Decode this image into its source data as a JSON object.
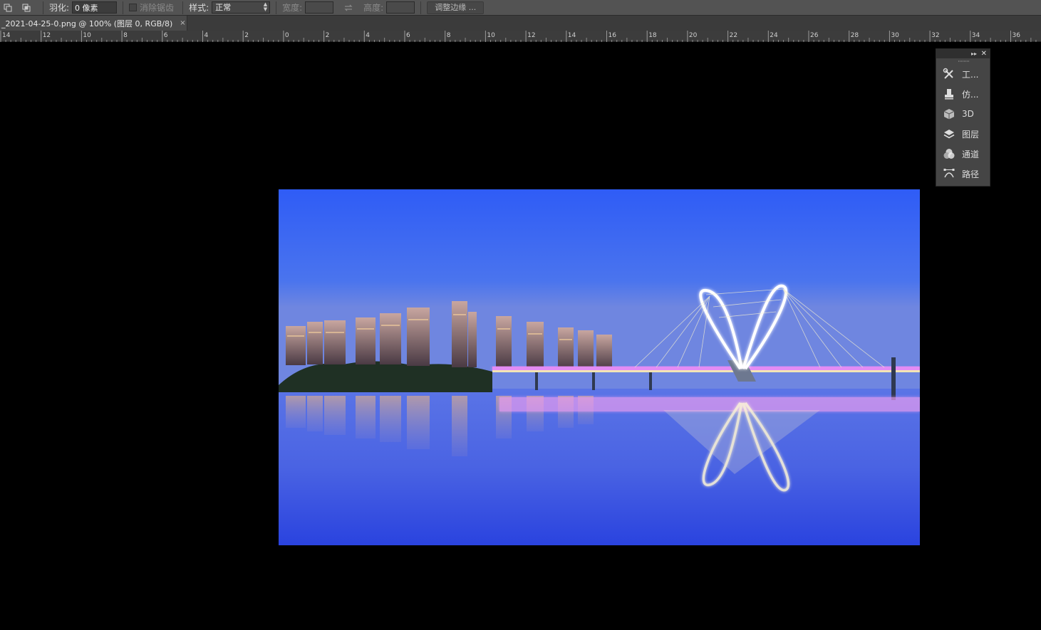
{
  "options_bar": {
    "feather_label": "羽化:",
    "feather_value": "0 像素",
    "antialias_label": "消除锯齿",
    "style_label": "样式:",
    "style_value": "正常",
    "width_label": "宽度:",
    "height_label": "高度:",
    "refine_edge_label": "调整边缘 ..."
  },
  "document": {
    "tab_title": "_2021-04-25-0.png @ 100% (图层 0, RGB/8)",
    "close_glyph": "×"
  },
  "ruler": {
    "labels": [
      "14",
      "12",
      "10",
      "8",
      "6",
      "4",
      "2",
      "0",
      "2",
      "4",
      "6",
      "8",
      "10",
      "12",
      "14",
      "16",
      "18",
      "20",
      "22",
      "24",
      "26",
      "28",
      "30",
      "32",
      "34",
      "36"
    ]
  },
  "panel": {
    "collapse_glyph": "▸▸",
    "close_glyph": "✕",
    "items": [
      {
        "label": "工...",
        "icon": "tools-icon"
      },
      {
        "label": "仿...",
        "icon": "clone-source-icon"
      },
      {
        "label": "3D",
        "icon": "cube-3d-icon"
      },
      {
        "label": "图层",
        "icon": "layers-icon"
      },
      {
        "label": "通道",
        "icon": "channels-icon"
      },
      {
        "label": "路径",
        "icon": "paths-icon"
      }
    ]
  },
  "colors": {
    "toolbar_bg": "#535353",
    "canvas_bg": "#000000",
    "panel_bg": "#454545",
    "sky_top": "#2f5cf6",
    "water": "#3650e0"
  }
}
